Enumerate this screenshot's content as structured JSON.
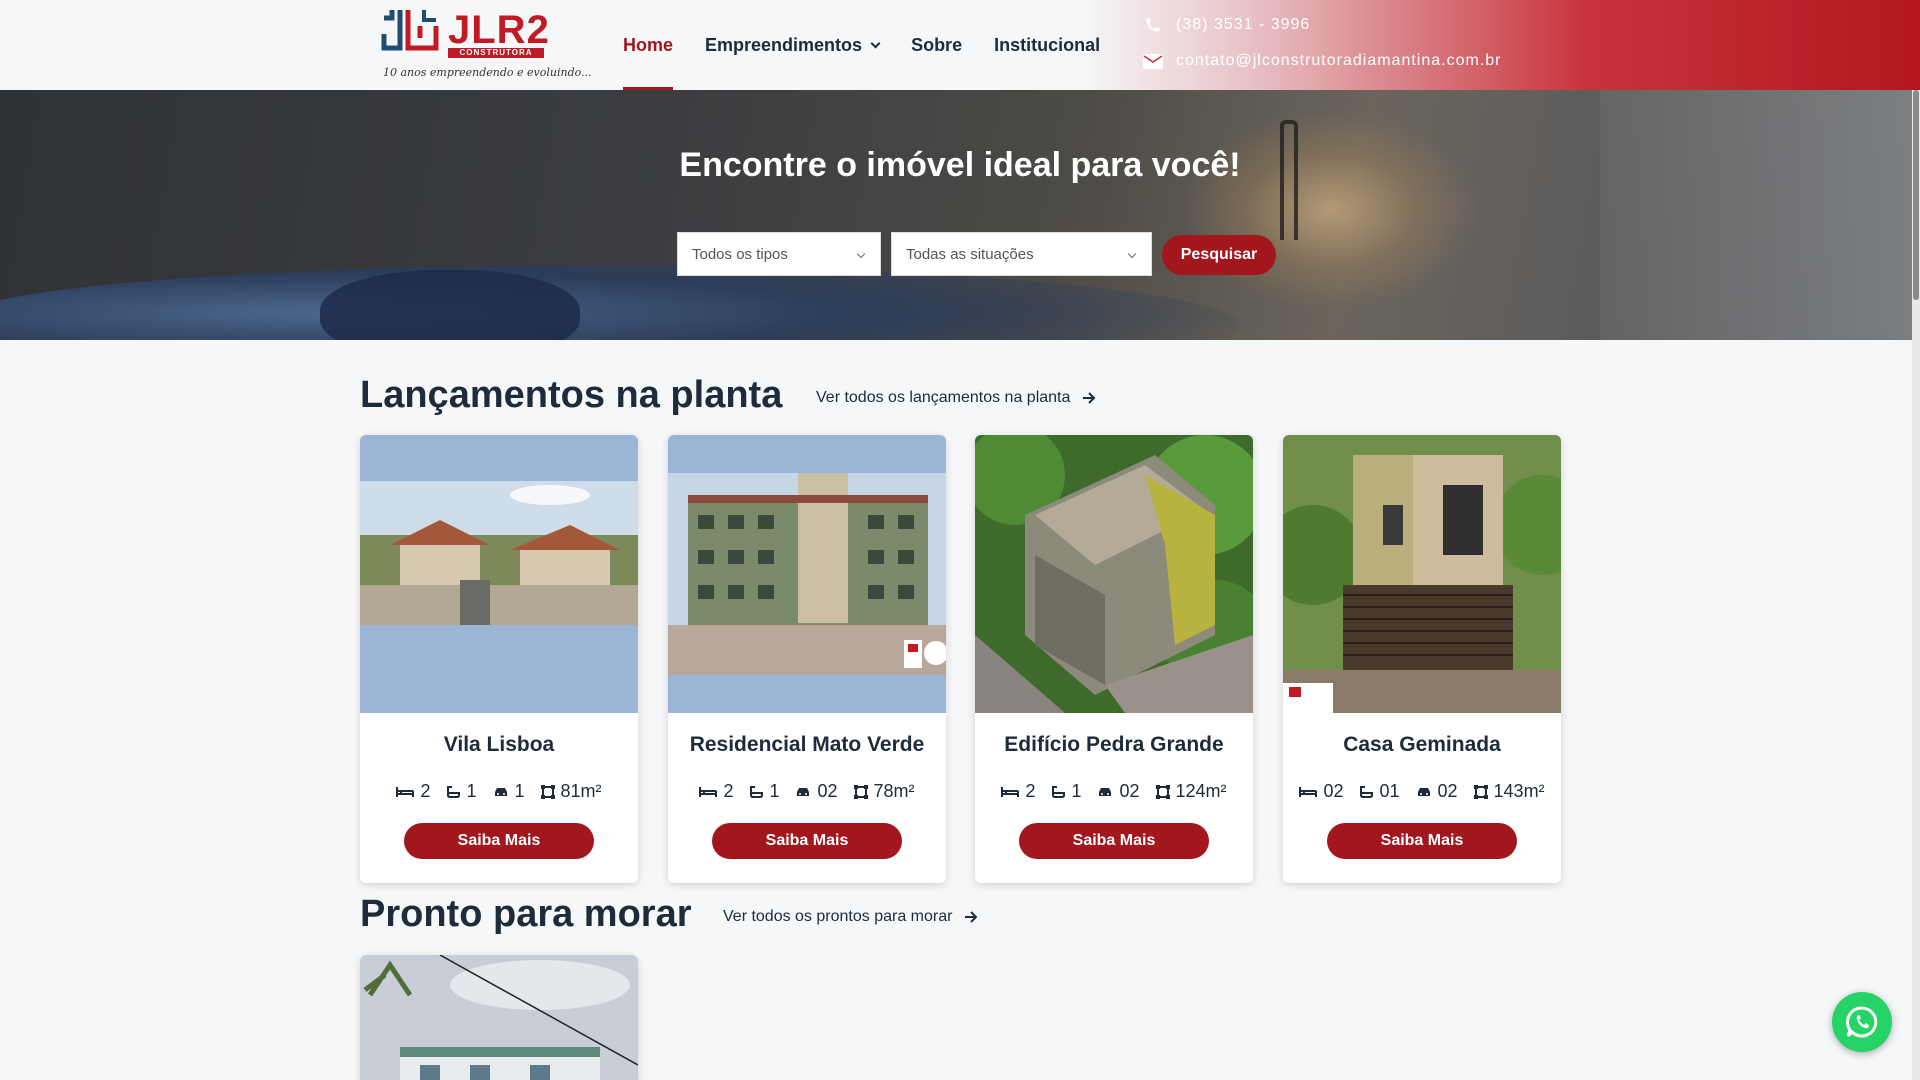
{
  "brand": {
    "name": "JLR2",
    "sub": "CONSTRUTORA",
    "slogan": "10 anos empreendendo e evoluindo...",
    "accent": "#a2161d"
  },
  "nav": {
    "items": [
      {
        "label": "Home",
        "active": true
      },
      {
        "label": "Empreendimentos",
        "dropdown": true
      },
      {
        "label": "Sobre"
      },
      {
        "label": "Institucional"
      }
    ]
  },
  "contact": {
    "phone": "(38) 3531 - 3996",
    "email": "contato@jlconstrutoradiamantina.com.br"
  },
  "hero": {
    "title": "Encontre o imóvel ideal para você!",
    "type_select": "Todos os tipos",
    "status_select": "Todas as situações",
    "search_label": "Pesquisar"
  },
  "launches": {
    "title": "Lançamentos na planta",
    "link": "Ver todos os lançamentos na planta",
    "cards": [
      {
        "title": "Vila Lisboa",
        "beds": "2",
        "baths": "1",
        "cars": "1",
        "area": "81m²",
        "button": "Saiba Mais"
      },
      {
        "title": "Residencial Mato Verde",
        "beds": "2",
        "baths": "1",
        "cars": "02",
        "area": "78m²",
        "button": "Saiba Mais"
      },
      {
        "title": "Edifício Pedra Grande",
        "beds": "2",
        "baths": "1",
        "cars": "02",
        "area": "124m²",
        "button": "Saiba Mais"
      },
      {
        "title": "Casa Geminada",
        "beds": "02",
        "baths": "01",
        "cars": "02",
        "area": "143m²",
        "button": "Saiba Mais"
      }
    ]
  },
  "ready": {
    "title": "Pronto para morar",
    "link": "Ver todos os prontos para morar"
  }
}
